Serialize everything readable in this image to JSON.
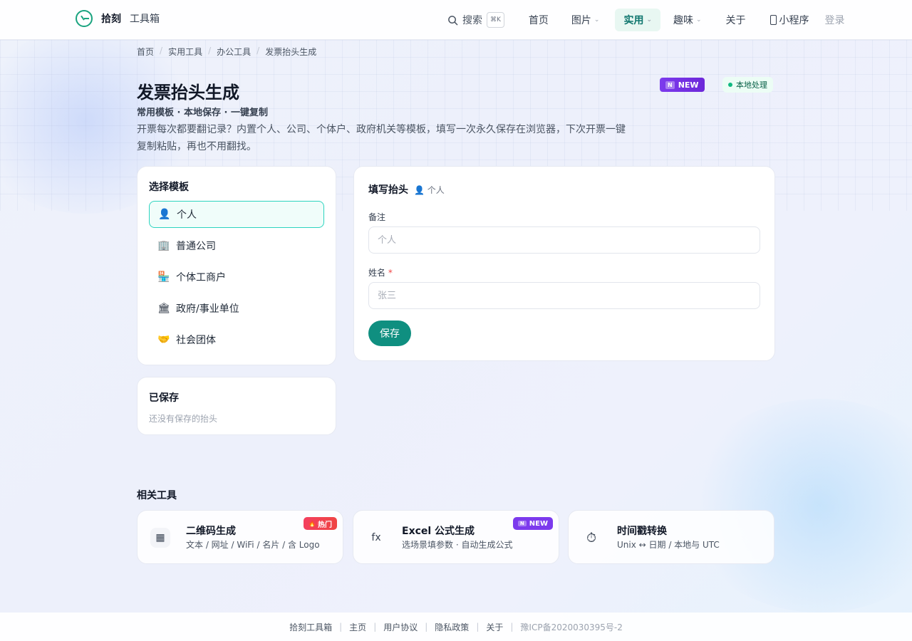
{
  "brand": {
    "name": "拾刻",
    "sub": "工具箱"
  },
  "nav": {
    "search_label": "搜索",
    "search_kbd": "⌘K",
    "home": "首页",
    "images": "图片",
    "practical": "实用",
    "fun": "趣味",
    "about": "关于",
    "mini_program": "小程序",
    "login": "登录"
  },
  "breadcrumb": [
    "首页",
    "实用工具",
    "办公工具",
    "发票抬头生成"
  ],
  "page": {
    "title": "发票抬头生成",
    "subtitle": "常用模板 · 本地保存 · 一键复制",
    "description": "开票每次都要翻记录？内置个人、公司、个体户、政府机关等模板，填写一次永久保存在浏览器，下次开票一键复制粘贴，再也不用翻找。",
    "badge_new": "NEW",
    "badge_new_prefix": "N",
    "badge_local": "本地处理"
  },
  "templates": {
    "heading": "选择模板",
    "items": [
      {
        "icon": "👤",
        "label": "个人"
      },
      {
        "icon": "🏢",
        "label": "普通公司"
      },
      {
        "icon": "🏪",
        "label": "个体工商户"
      },
      {
        "icon": "🏛",
        "label": "政府/事业单位"
      },
      {
        "icon": "🤝",
        "label": "社会团体"
      }
    ]
  },
  "saved": {
    "heading": "已保存",
    "empty": "还没有保存的抬头"
  },
  "form": {
    "heading": "填写抬头",
    "tag": "👤 个人",
    "note_label": "备注",
    "note_placeholder": "个人",
    "name_label": "姓名",
    "name_required": "*",
    "name_placeholder": "张三",
    "save": "保存"
  },
  "related": {
    "heading": "相关工具",
    "tools": [
      {
        "icon": "▦",
        "name": "二维码生成",
        "desc": "文本 / 网址 / WiFi / 名片 / 含 Logo",
        "tag": "热门",
        "tag_icon": "🔥"
      },
      {
        "icon": "fx",
        "name": "Excel 公式生成",
        "desc": "选场景填参数 · 自动生成公式",
        "tag": "NEW",
        "tag_prefix": "N"
      },
      {
        "icon": "⏱",
        "name": "时间戳转换",
        "desc": "Unix ↔ 日期 / 本地与 UTC"
      }
    ]
  },
  "footer": {
    "items": [
      "拾刻工具箱",
      "主页",
      "用户协议",
      "隐私政策",
      "关于"
    ],
    "icp": "豫ICP备2020030395号-2"
  },
  "colors": {
    "accent": "#0f8f80",
    "accent_light": "#2dd4bf",
    "new_badge": "#7c3aed",
    "hot_badge": "#ef4444"
  }
}
